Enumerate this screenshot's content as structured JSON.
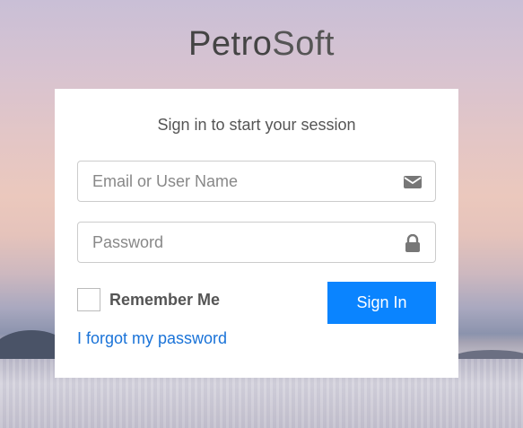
{
  "brand": {
    "part1": "Petro",
    "part2": "Soft"
  },
  "login": {
    "message": "Sign in to start your session",
    "email_placeholder": "Email or User Name",
    "password_placeholder": "Password",
    "remember_label": "Remember Me",
    "remember_checked": false,
    "signin_label": "Sign In",
    "forgot_label": "I forgot my password"
  },
  "icons": {
    "email": "envelope-icon",
    "password": "lock-icon"
  },
  "colors": {
    "primary": "#0a84ff",
    "link": "#1a73d8"
  }
}
